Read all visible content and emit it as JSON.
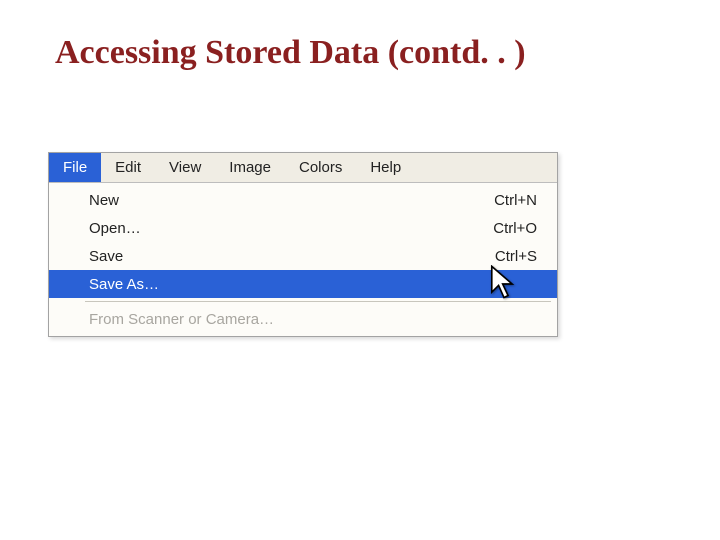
{
  "title": "Accessing Stored Data (contd. . )",
  "menubar": {
    "file": "File",
    "edit": "Edit",
    "view": "View",
    "image": "Image",
    "colors": "Colors",
    "help": "Help"
  },
  "dropdown": {
    "new_label": "New",
    "new_shortcut": "Ctrl+N",
    "open_label": "Open…",
    "open_shortcut": "Ctrl+O",
    "save_label": "Save",
    "save_shortcut": "Ctrl+S",
    "save_as_label": "Save As…",
    "scanner_label": "From Scanner or Camera…"
  }
}
